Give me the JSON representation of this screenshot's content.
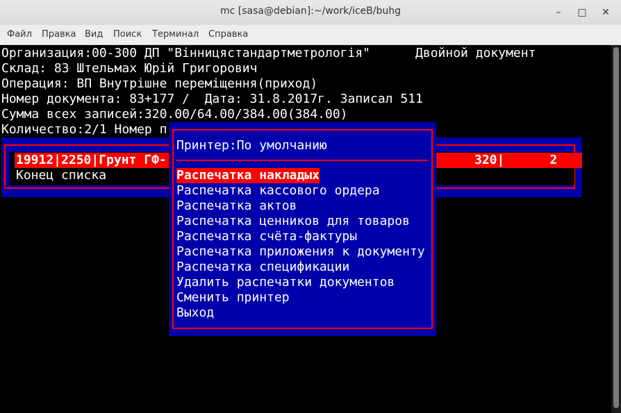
{
  "window": {
    "title": "mc [sasa@debian]:~/work/iceB/buhg"
  },
  "menubar": {
    "items": [
      "Файл",
      "Правка",
      "Вид",
      "Поиск",
      "Терминал",
      "Справка"
    ]
  },
  "header": {
    "line1": "Организация:00-300 ДП \"Вінницястандартметрологія\"      Двойной документ",
    "line2": "Склад: 83 Штельмах Юрій Григорович",
    "line3": "Операция: ВП Внутрішне переміщення(приход)",
    "line4": "Номер документа: 83+177 /  Дата: 31.8.2017г. Записал 511",
    "line5": "Сумма всех записей:320.00/64.00/384.00(384.00)",
    "line6": "Количество:2/1 Номер п"
  },
  "list": {
    "row_left": "19912|2250|Грунт ГФ-",
    "row_right": "320|      2",
    "end": "Конец списка"
  },
  "dialog": {
    "printer": "Принтер:По умолчанию",
    "selected_index": 0,
    "items": [
      "Распечатка накладых",
      "Распечатка кассового ордера",
      "Распечатка актов",
      "Распечатка ценников для товаров",
      "Распечатка счёта-фактуры",
      "Распечатка приложения к документу",
      "Распечатка спецификации",
      "Удалить распечатки документов",
      "Сменить принтер",
      "Выход"
    ]
  }
}
